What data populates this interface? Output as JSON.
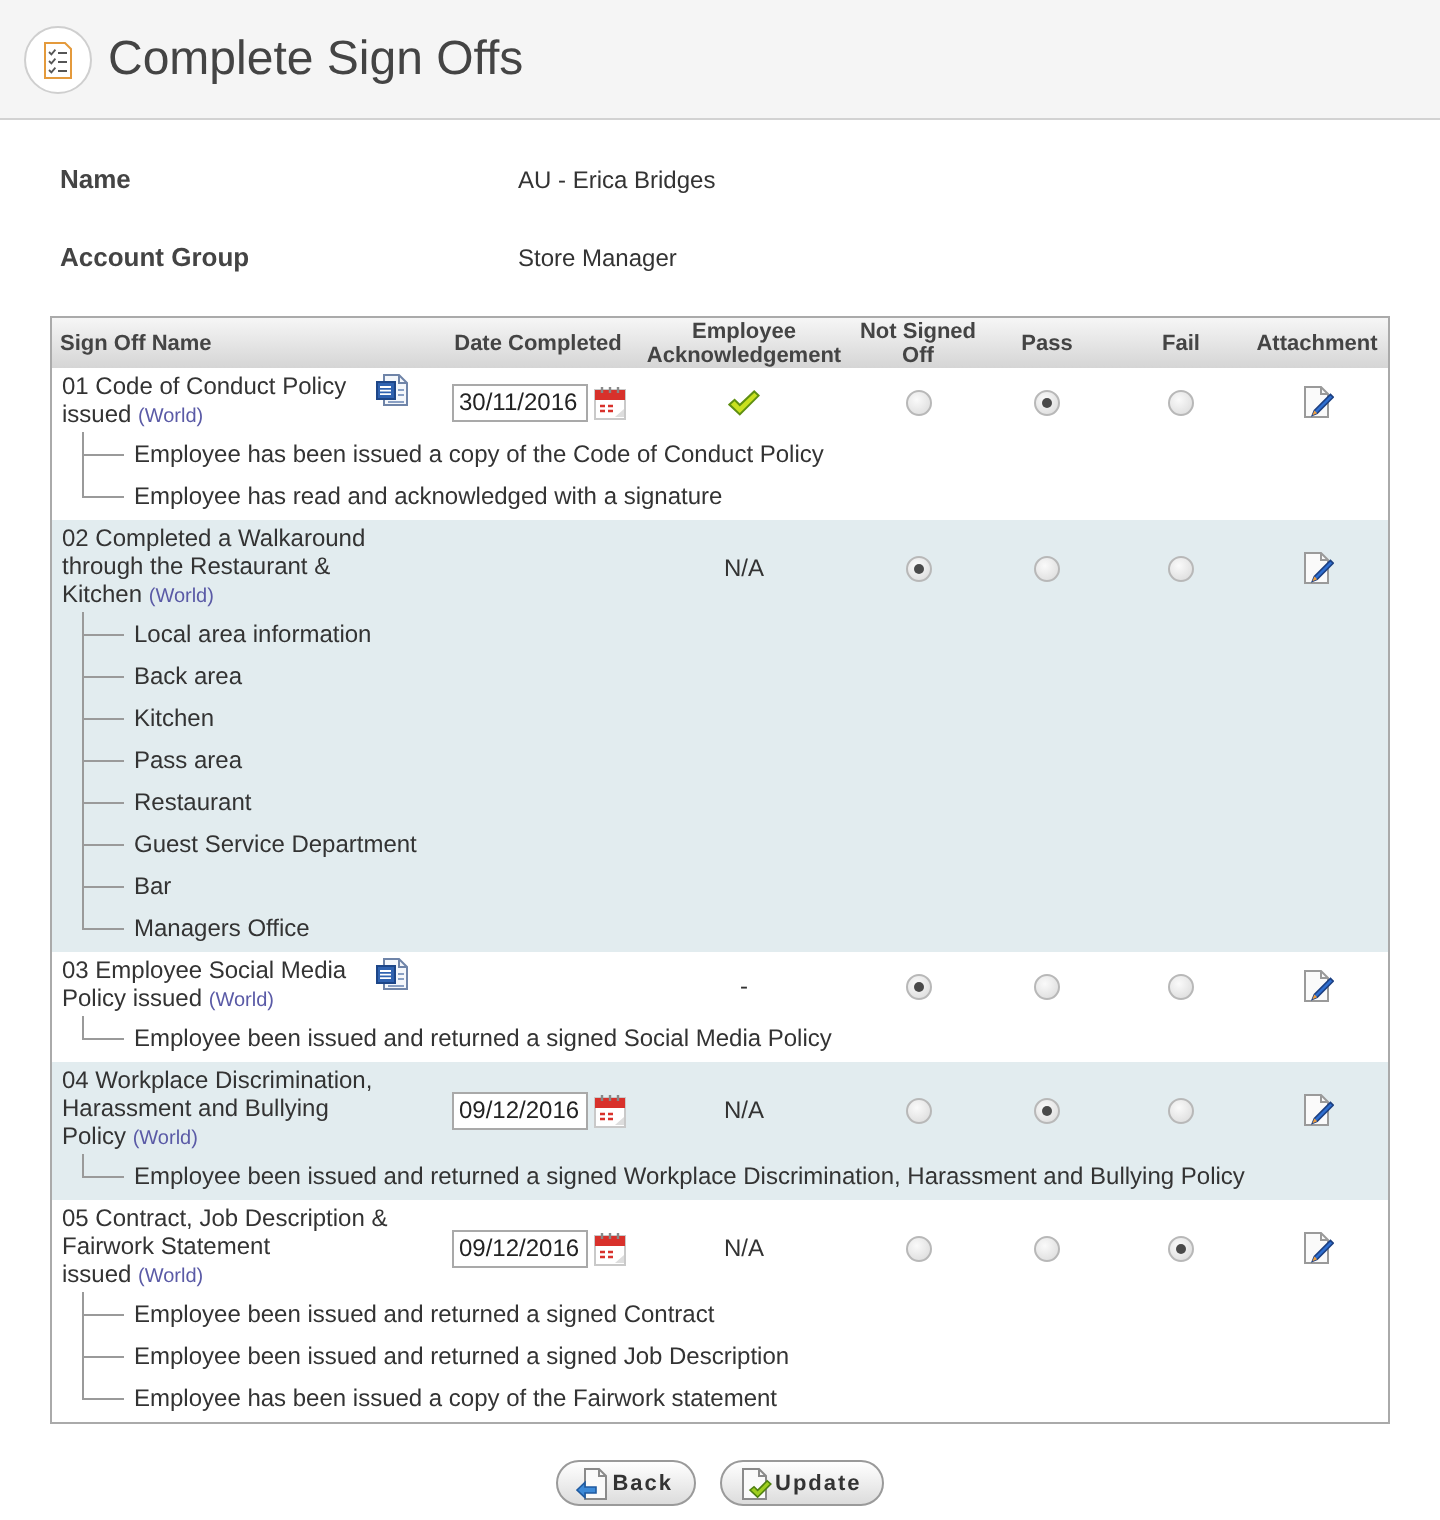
{
  "header": {
    "title": "Complete Sign Offs"
  },
  "details": [
    {
      "label": "Name",
      "value": "AU - Erica Bridges"
    },
    {
      "label": "Account Group",
      "value": "Store Manager"
    }
  ],
  "table": {
    "columns": [
      "Sign Off Name",
      "Date Completed",
      "Employee Acknowledgement",
      "Not Signed Off",
      "Pass",
      "Fail",
      "Attachment"
    ],
    "rows": [
      {
        "title": "01 Code of Conduct Policy issued",
        "scope": "(World)",
        "document": true,
        "date": "30/11/2016",
        "acknowledgement": {
          "kind": "check"
        },
        "options": [
          {
            "selected": false
          },
          {
            "selected": true
          },
          {
            "selected": false
          }
        ],
        "children": [
          {
            "label": "Employee has been issued a copy of the Code of Conduct Policy"
          },
          {
            "label": "Employee has read and acknowledged with a signature"
          }
        ]
      },
      {
        "title": "02 Completed a Walkaround through the Restaurant & Kitchen",
        "scope": "(World)",
        "document": false,
        "acknowledgement": {
          "kind": "text",
          "text": "N/A"
        },
        "options": [
          {
            "selected": true
          },
          {
            "selected": false
          },
          {
            "selected": false
          }
        ],
        "children": [
          {
            "label": "Local area information"
          },
          {
            "label": "Back area"
          },
          {
            "label": "Kitchen"
          },
          {
            "label": "Pass area"
          },
          {
            "label": "Restaurant"
          },
          {
            "label": "Guest Service Department"
          },
          {
            "label": "Bar"
          },
          {
            "label": "Managers Office"
          }
        ]
      },
      {
        "title": "03 Employee Social Media Policy issued",
        "scope": "(World)",
        "document": true,
        "acknowledgement": {
          "kind": "text",
          "text": "-"
        },
        "options": [
          {
            "selected": true
          },
          {
            "selected": false
          },
          {
            "selected": false
          }
        ],
        "children": [
          {
            "label": "Employee been issued and returned a signed Social Media Policy"
          }
        ]
      },
      {
        "title": "04 Workplace Discrimination, Harassment and Bullying Policy",
        "scope": "(World)",
        "document": false,
        "date": "09/12/2016",
        "acknowledgement": {
          "kind": "text",
          "text": "N/A"
        },
        "options": [
          {
            "selected": false
          },
          {
            "selected": true
          },
          {
            "selected": false
          }
        ],
        "children": [
          {
            "label": "Employee been issued and returned a signed Workplace Discrimination, Harassment and Bullying Policy"
          }
        ]
      },
      {
        "title": "05 Contract, Job Description & Fairwork Statement issued",
        "scope": "(World)",
        "document": false,
        "date": "09/12/2016",
        "acknowledgement": {
          "kind": "text",
          "text": "N/A"
        },
        "options": [
          {
            "selected": false
          },
          {
            "selected": false
          },
          {
            "selected": true
          }
        ],
        "children": [
          {
            "label": "Employee been issued and returned a signed Contract"
          },
          {
            "label": "Employee been issued and returned a signed Job Description"
          },
          {
            "label": "Employee has been issued a copy of the Fairwork statement"
          }
        ]
      }
    ]
  },
  "buttons": [
    {
      "label": "Back",
      "kind": "back"
    },
    {
      "label": "Update",
      "kind": "update"
    }
  ]
}
